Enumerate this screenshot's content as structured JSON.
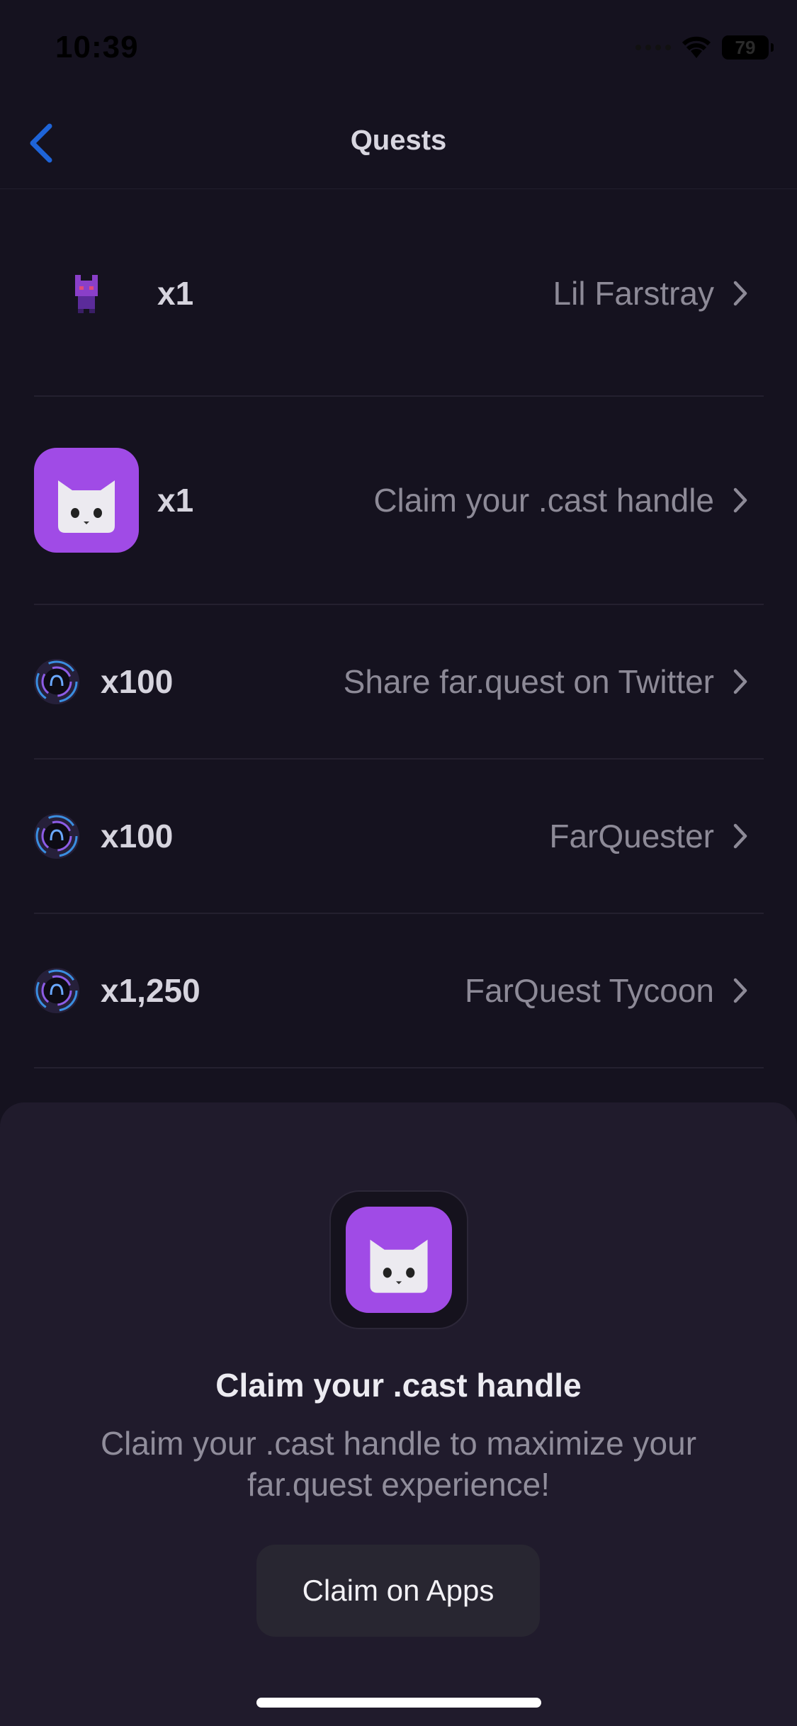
{
  "status_bar": {
    "time": "10:39",
    "battery": "79"
  },
  "nav": {
    "title": "Quests",
    "back_icon": "chevron-left-icon"
  },
  "quests": [
    {
      "count": "x1",
      "name": "Lil Farstray",
      "icon": "farstray-avatar-icon"
    },
    {
      "count": "x1",
      "name": "Claim your .cast handle",
      "icon": "cat-app-icon"
    },
    {
      "count": "x100",
      "name": "Share far.quest on Twitter",
      "icon": "farquest-coin-icon"
    },
    {
      "count": "x100",
      "name": "FarQuester",
      "icon": "farquest-coin-icon"
    },
    {
      "count": "x1,250",
      "name": "FarQuest Tycoon",
      "icon": "farquest-coin-icon"
    }
  ],
  "sheet": {
    "title": "Claim your .cast handle",
    "description": "Claim your .cast handle to maximize your far.quest experience!",
    "button_label": "Claim on Apps"
  },
  "colors": {
    "background": "#15121f",
    "sheet": "#201b2c",
    "accent_purple": "#a04be6",
    "back_blue": "#1e64d8"
  }
}
